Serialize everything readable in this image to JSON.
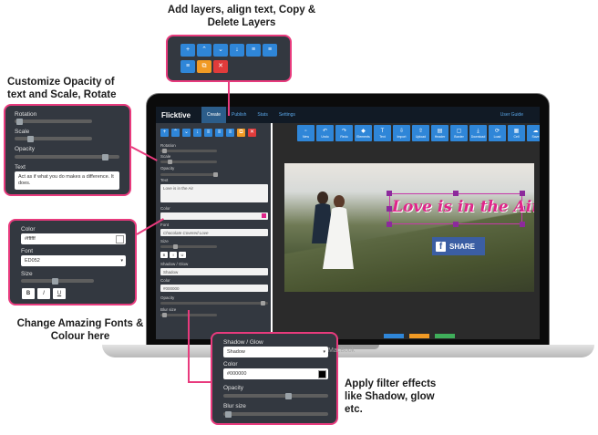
{
  "captions": {
    "top": "Add layers, align text, Copy & Delete Layers",
    "opacity": "Customize Opacity of text and Scale, Rotate",
    "fonts": "Change Amazing Fonts & Colour here",
    "filter": "Apply filter effects like Shadow, glow etc."
  },
  "app": {
    "brand": "Flicktive",
    "tabs": [
      "Create",
      "Publish",
      "Stats",
      "Settings"
    ],
    "active_tab": "Create",
    "user_guide": "User Guide",
    "device_label": "MacBook"
  },
  "layer_toolbar": {
    "icons": [
      "plus-icon",
      "chevron-up-icon",
      "chevron-down-icon",
      "arrow-down-icon",
      "align-left-icon",
      "align-center-icon",
      "align-right-icon",
      "copy-icon",
      "delete-icon"
    ]
  },
  "canvas_toolbar": {
    "buttons": [
      {
        "label": "New",
        "icon": "file-icon"
      },
      {
        "label": "Undo",
        "icon": "undo-icon"
      },
      {
        "label": "Redo",
        "icon": "redo-icon"
      },
      {
        "label": "Elements",
        "icon": "elements-icon"
      },
      {
        "label": "Text",
        "icon": "text-icon"
      },
      {
        "label": "Import",
        "icon": "import-icon"
      },
      {
        "label": "Upload",
        "icon": "upload-icon"
      },
      {
        "label": "Header",
        "icon": "header-icon"
      },
      {
        "label": "Border",
        "icon": "border-icon"
      },
      {
        "label": "Download",
        "icon": "download-icon"
      },
      {
        "label": "Load",
        "icon": "load-icon"
      },
      {
        "label": "Cell",
        "icon": "cell-icon"
      },
      {
        "label": "Save",
        "icon": "save-icon"
      }
    ]
  },
  "panel": {
    "rotation_label": "Rotation",
    "scale_label": "Scale",
    "opacity_label": "Opacity",
    "text_label": "Text",
    "text_value": "Love is in the Air",
    "color_label": "Color",
    "font_label": "Font",
    "font_value": "Chocolate Covered Love",
    "size_label": "Size",
    "shadow_label": "Shadow / Glow",
    "shadow_value": "Shadow",
    "shadow_color_label": "Color",
    "shadow_color_value": "#000000",
    "shadow_opacity_label": "Opacity",
    "blur_label": "Blur size"
  },
  "canvas": {
    "headline": "Love is in the Air",
    "share_label": "SHARE",
    "share_icon": "facebook-icon"
  },
  "callout_opacity": {
    "rotation_label": "Rotation",
    "scale_label": "Scale",
    "opacity_label": "Opacity",
    "text_label": "Text",
    "text_value": "Act as if what you do makes a difference. It does."
  },
  "callout_font": {
    "color_label": "Color",
    "color_value": "#ffffff",
    "font_label": "Font",
    "font_value": "ED052",
    "size_label": "Size",
    "format_buttons": [
      "B",
      "I",
      "U"
    ]
  },
  "callout_filter": {
    "shadow_label": "Shadow / Glow",
    "shadow_value": "Shadow",
    "color_label": "Color",
    "color_value": "#000000",
    "opacity_label": "Opacity",
    "blur_label": "Blur size"
  },
  "colors": {
    "accent": "#e83a7d",
    "button_blue": "#2f86d8",
    "button_orange": "#f19a24",
    "button_red": "#e03b3b",
    "panel_dark": "#333840",
    "headline_pink": "#e0258a"
  }
}
